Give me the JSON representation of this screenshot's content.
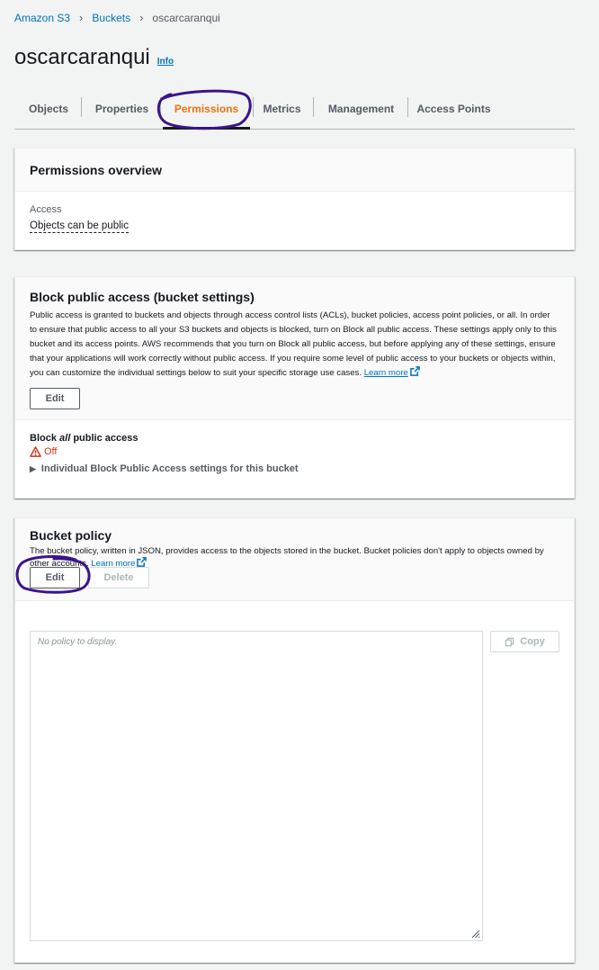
{
  "breadcrumb": {
    "items": [
      "Amazon S3",
      "Buckets"
    ],
    "current": "oscarcaranqui"
  },
  "page": {
    "title": "oscarcaranqui",
    "info": "Info"
  },
  "tabs": [
    "Objects",
    "Properties",
    "Permissions",
    "Metrics",
    "Management",
    "Access Points"
  ],
  "active_tab": "Permissions",
  "permissions_overview": {
    "title": "Permissions overview",
    "access_label": "Access",
    "access_value": "Objects can be public"
  },
  "block_public_access": {
    "title": "Block public access (bucket settings)",
    "description": "Public access is granted to buckets and objects through access control lists (ACLs), bucket policies, access point policies, or all. In order to ensure that public access to all your S3 buckets and objects is blocked, turn on Block all public access. These settings apply only to this bucket and its access points. AWS recommends that you turn on Block all public access, but before applying any of these settings, ensure that your applications will work correctly without public access. If you require some level of public access to your buckets or objects within, you can customize the individual settings below to suit your specific storage use cases.",
    "learn_more": "Learn more",
    "edit_label": "Edit",
    "setting_prefix": "Block",
    "setting_emphasis": "all",
    "setting_suffix": "public access",
    "status": "Off",
    "expander": "Individual Block Public Access settings for this bucket"
  },
  "bucket_policy": {
    "title": "Bucket policy",
    "description": "The bucket policy, written in JSON, provides access to the objects stored in the bucket. Bucket policies don't apply to objects owned by other accounts.",
    "learn_more": "Learn more",
    "edit_label": "Edit",
    "delete_label": "Delete",
    "placeholder": "No policy to display.",
    "copy_label": "Copy"
  },
  "colors": {
    "link": "#0073bb",
    "active_tab": "#ec7211",
    "warning": "#d13212",
    "annotation": "#3b148c"
  }
}
